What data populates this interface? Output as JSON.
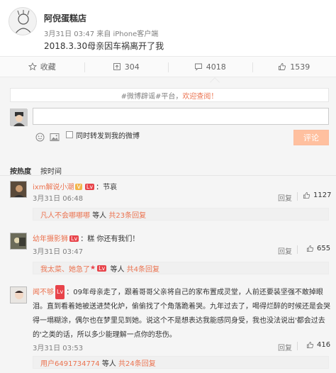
{
  "post": {
    "author": "阿倪蛋糕店",
    "time": "3月31日 03:47",
    "source_prefix": "来自",
    "source": "iPhone客户端",
    "text": "2018.3.30母亲因车祸离开了我"
  },
  "actions": {
    "favorite": "收藏",
    "repost": "304",
    "comment": "4018",
    "like": "1539"
  },
  "composer": {
    "notice_prefix": "#微博辟谣#平台，",
    "notice_highlight": "欢迎查阅！",
    "input_value": "",
    "repost_label": "同时转发到我的微博",
    "submit_label": "评论"
  },
  "sort": {
    "hot": "按热度",
    "time": "按时间"
  },
  "comments": [
    {
      "name": "ixm解说小潮",
      "badge1": "V",
      "badge2": "Lv",
      "text": "：节哀",
      "time": "3月31日 06:48",
      "reply": "回复",
      "likes": "1127",
      "sub_name": "凡人不会哪哪哪",
      "sub_mid": "等人",
      "sub_count": "共23条回复"
    },
    {
      "name": "幼年摄影狮",
      "badge2": "Lv",
      "text": "：糕 你还有我们！",
      "time": "3月31日 03:47",
      "reply": "回复",
      "likes": "655",
      "sub_name": "我太菜、她急了",
      "sub_mid": "等人",
      "sub_count": "共4条回复"
    },
    {
      "name": "闻不够",
      "badge2": "Lv",
      "text": "：09年母亲走了，跟着哥哥父亲将自己的家布置成灵堂，人前还要装坚强不敢掉眼泪。直到看着她被送进焚化炉，偷偷找了个角落跪着哭。九年过去了，喝得烂醉的时候还是会哭得一塌糊涂，偶尔也在梦里见到她。说这个不是想表达我能感同身受，我也没法说出'都会过去的'之类的话，所以多少能理解一点你的悲伤。",
      "time": "3月31日 03:53",
      "reply": "回复",
      "likes": "416",
      "sub_name": "用户6491734774",
      "sub_mid": "等人",
      "sub_count": "共24条回复"
    }
  ],
  "icons": {
    "favorite": "star-outline-icon",
    "repost": "repost-icon",
    "comment": "comment-icon",
    "like": "thumbs-up-icon",
    "emoji": "smiley-icon",
    "image": "image-icon"
  },
  "colors": {
    "accent": "#eb7350",
    "submit_bg": "#ffc09f",
    "panel_bg": "#f5f5f5"
  }
}
